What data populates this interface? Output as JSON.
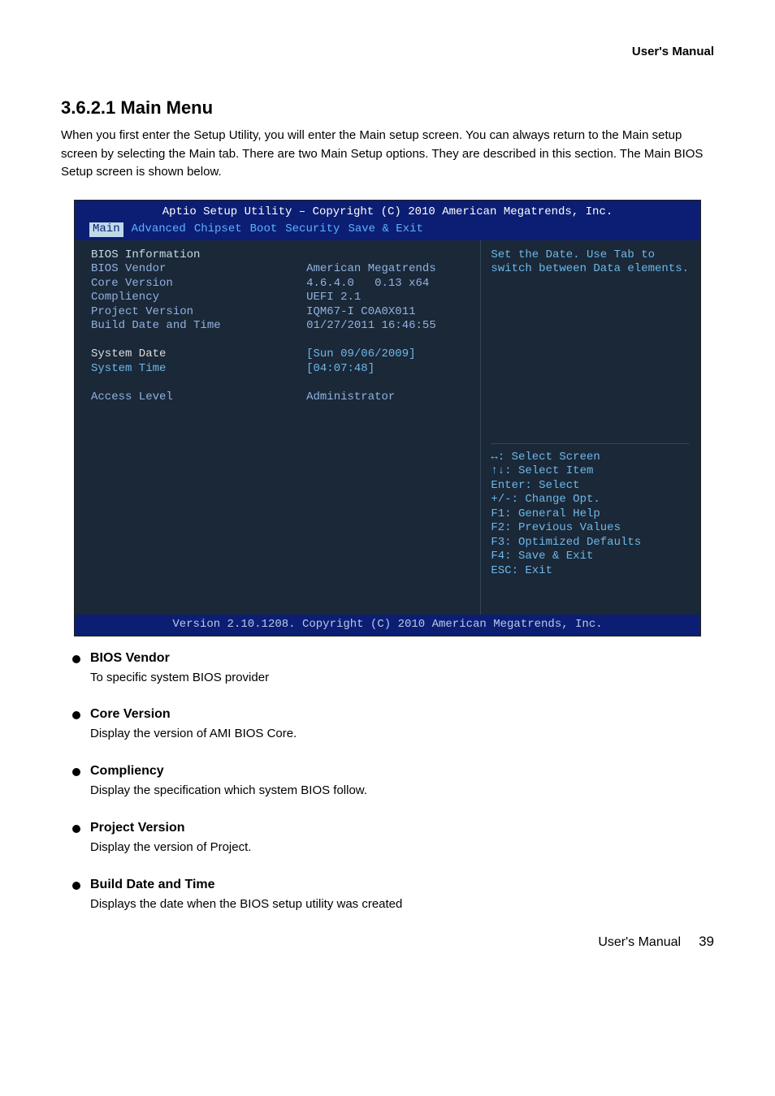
{
  "header": {
    "title": "User's Manual"
  },
  "section": {
    "title": "3.6.2.1 Main Menu",
    "intro": "When you first enter the Setup Utility, you will enter the Main setup screen. You can always return to the Main setup screen by selecting the Main tab. There are two Main Setup options. They are described in this section. The Main BIOS Setup screen is shown below."
  },
  "bios": {
    "title": "Aptio Setup Utility – Copyright (C) 2010 American Megatrends, Inc.",
    "tabs": [
      "Main",
      "Advanced",
      "Chipset",
      "Boot",
      "Security",
      "Save & Exit"
    ],
    "left": {
      "heading": "BIOS Information",
      "labels": [
        "BIOS Vendor",
        "Core Version",
        "Compliency",
        "Project Version",
        "Build Date and Time",
        "System Date",
        "System Time",
        "Access Level"
      ]
    },
    "mid": {
      "values": [
        "American Megatrends",
        "4.6.4.0   0.13 x64",
        "UEFI 2.1",
        "IQM67-I C0A0X011",
        "01/27/2011 16:46:55",
        "[Sun 09/06/2009]",
        "[04:07:48]",
        "Administrator"
      ]
    },
    "help": [
      "Set the Date. Use Tab to",
      "switch between Data elements."
    ],
    "keys": [
      "↔: Select Screen",
      "↑↓: Select Item",
      "Enter: Select",
      "+/-: Change Opt.",
      "F1: General Help",
      "F2: Previous Values",
      "F3: Optimized Defaults",
      "F4: Save & Exit",
      "ESC: Exit"
    ],
    "footer": "Version 2.10.1208. Copyright (C) 2010 American Megatrends, Inc."
  },
  "bullets": [
    {
      "title": "BIOS Vendor",
      "body": "To specific system BIOS provider"
    },
    {
      "title": "Core Version",
      "body": "Display the version of AMI BIOS Core."
    },
    {
      "title": "Compliency",
      "body": "Display the specification which system BIOS follow."
    },
    {
      "title": "Project Version",
      "body": "Display the version of Project."
    },
    {
      "title": "Build Date and Time",
      "body": "Displays the date when the BIOS setup utility was created"
    }
  ],
  "footer": {
    "label": "User's Manual",
    "number": "39"
  }
}
